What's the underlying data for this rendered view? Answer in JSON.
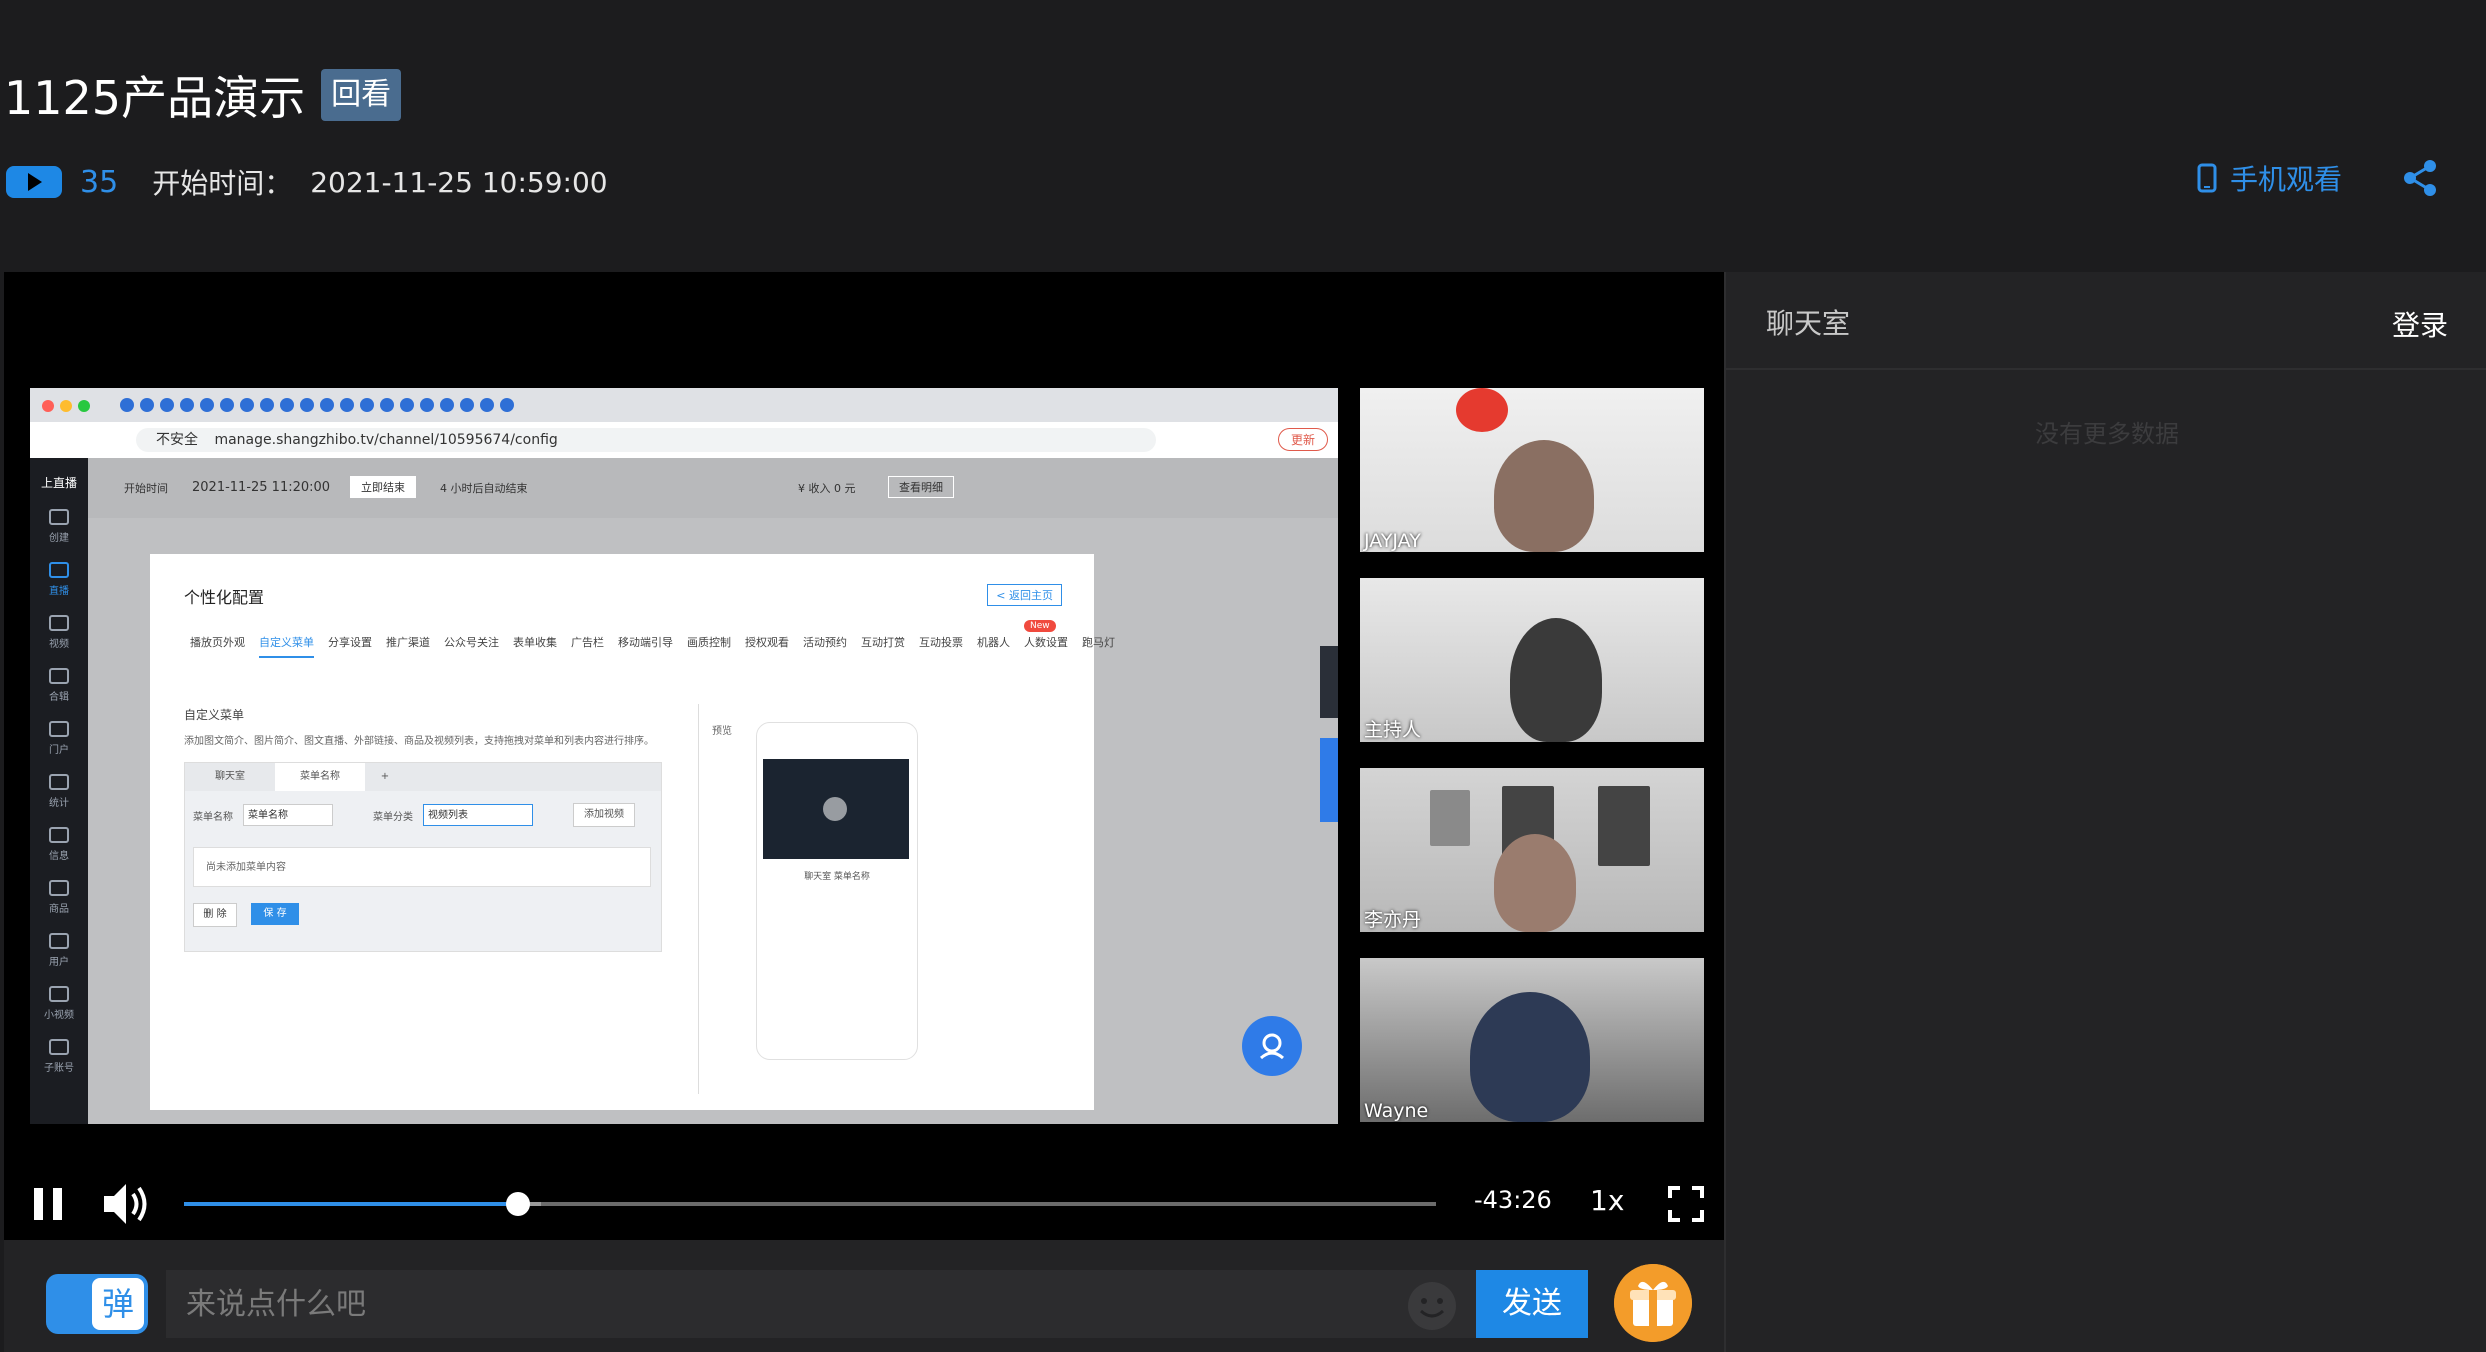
{
  "header": {
    "title": "1125产品演示",
    "badge": "回看",
    "view_count": "35",
    "start_label": "开始时间：",
    "start_time": "2021-11-25 10:59:00",
    "mobile_watch": "手机观看",
    "accent": "#2f8fe8"
  },
  "screen_share": {
    "url": "manage.shangzhibo.tv/channel/10595674/config",
    "insecure_label": "不安全",
    "update_label": "更新",
    "app_name": "上直播",
    "sidebar": [
      {
        "label": "创建",
        "icon": "plus-icon"
      },
      {
        "label": "直播",
        "icon": "live-icon"
      },
      {
        "label": "视频",
        "icon": "video-icon"
      },
      {
        "label": "合辑",
        "icon": "album-icon"
      },
      {
        "label": "门户",
        "icon": "portal-icon"
      },
      {
        "label": "统计",
        "icon": "chart-icon"
      },
      {
        "label": "信息",
        "icon": "info-icon"
      },
      {
        "label": "商品",
        "icon": "shop-icon"
      },
      {
        "label": "用户",
        "icon": "user-icon"
      },
      {
        "label": "小视频",
        "icon": "short-video-icon"
      },
      {
        "label": "子账号",
        "icon": "sub-account-icon"
      }
    ],
    "topbar": {
      "start_label": "开始时间",
      "start_time": "2021-11-25 11:20:00",
      "end_button": "立即结束",
      "auto_end": "4 小时后自动结束",
      "income": "¥ 收入 0 元",
      "view_income": "查看明细"
    },
    "card": {
      "title": "个性化配置",
      "back": "< 返回主页",
      "tabs": [
        "播放页外观",
        "自定义菜单",
        "分享设置",
        "推广渠道",
        "公众号关注",
        "表单收集",
        "广告栏",
        "移动端引导",
        "画质控制",
        "授权观看",
        "活动预约",
        "互动打赏",
        "互动投票",
        "机器人",
        "人数设置",
        "跑马灯"
      ],
      "new_tag": "New",
      "section_title": "自定义菜单",
      "section_desc": "添加图文简介、图片简介、图文直播、外部链接、商品及视频列表，支持拖拽对菜单和列表内容进行排序。",
      "editor_tabs": [
        "聊天室",
        "菜单名称",
        "+"
      ],
      "menu_name_label": "菜单名称",
      "menu_name_value": "菜单名称",
      "menu_type_label": "菜单分类",
      "menu_type_value": "视频列表",
      "add_video": "添加视频",
      "empty_text": "尚未添加菜单内容",
      "delete_btn": "删 除",
      "save_btn": "保 存",
      "preview_label": "预览",
      "preview_caption": "聊天室  菜单名称"
    }
  },
  "participants": [
    {
      "name": "JAYJAY"
    },
    {
      "name": "主持人"
    },
    {
      "name": "李亦丹"
    },
    {
      "name": "Wayne"
    }
  ],
  "player": {
    "progress": 0.267,
    "buffered": 0.285,
    "time_remaining": "-43:26",
    "speed": "1x"
  },
  "chat_bar": {
    "danmaku": "弹",
    "placeholder": "来说点什么吧",
    "send": "发送"
  },
  "chat_panel": {
    "title": "聊天室",
    "login": "登录",
    "empty": "没有更多数据"
  }
}
